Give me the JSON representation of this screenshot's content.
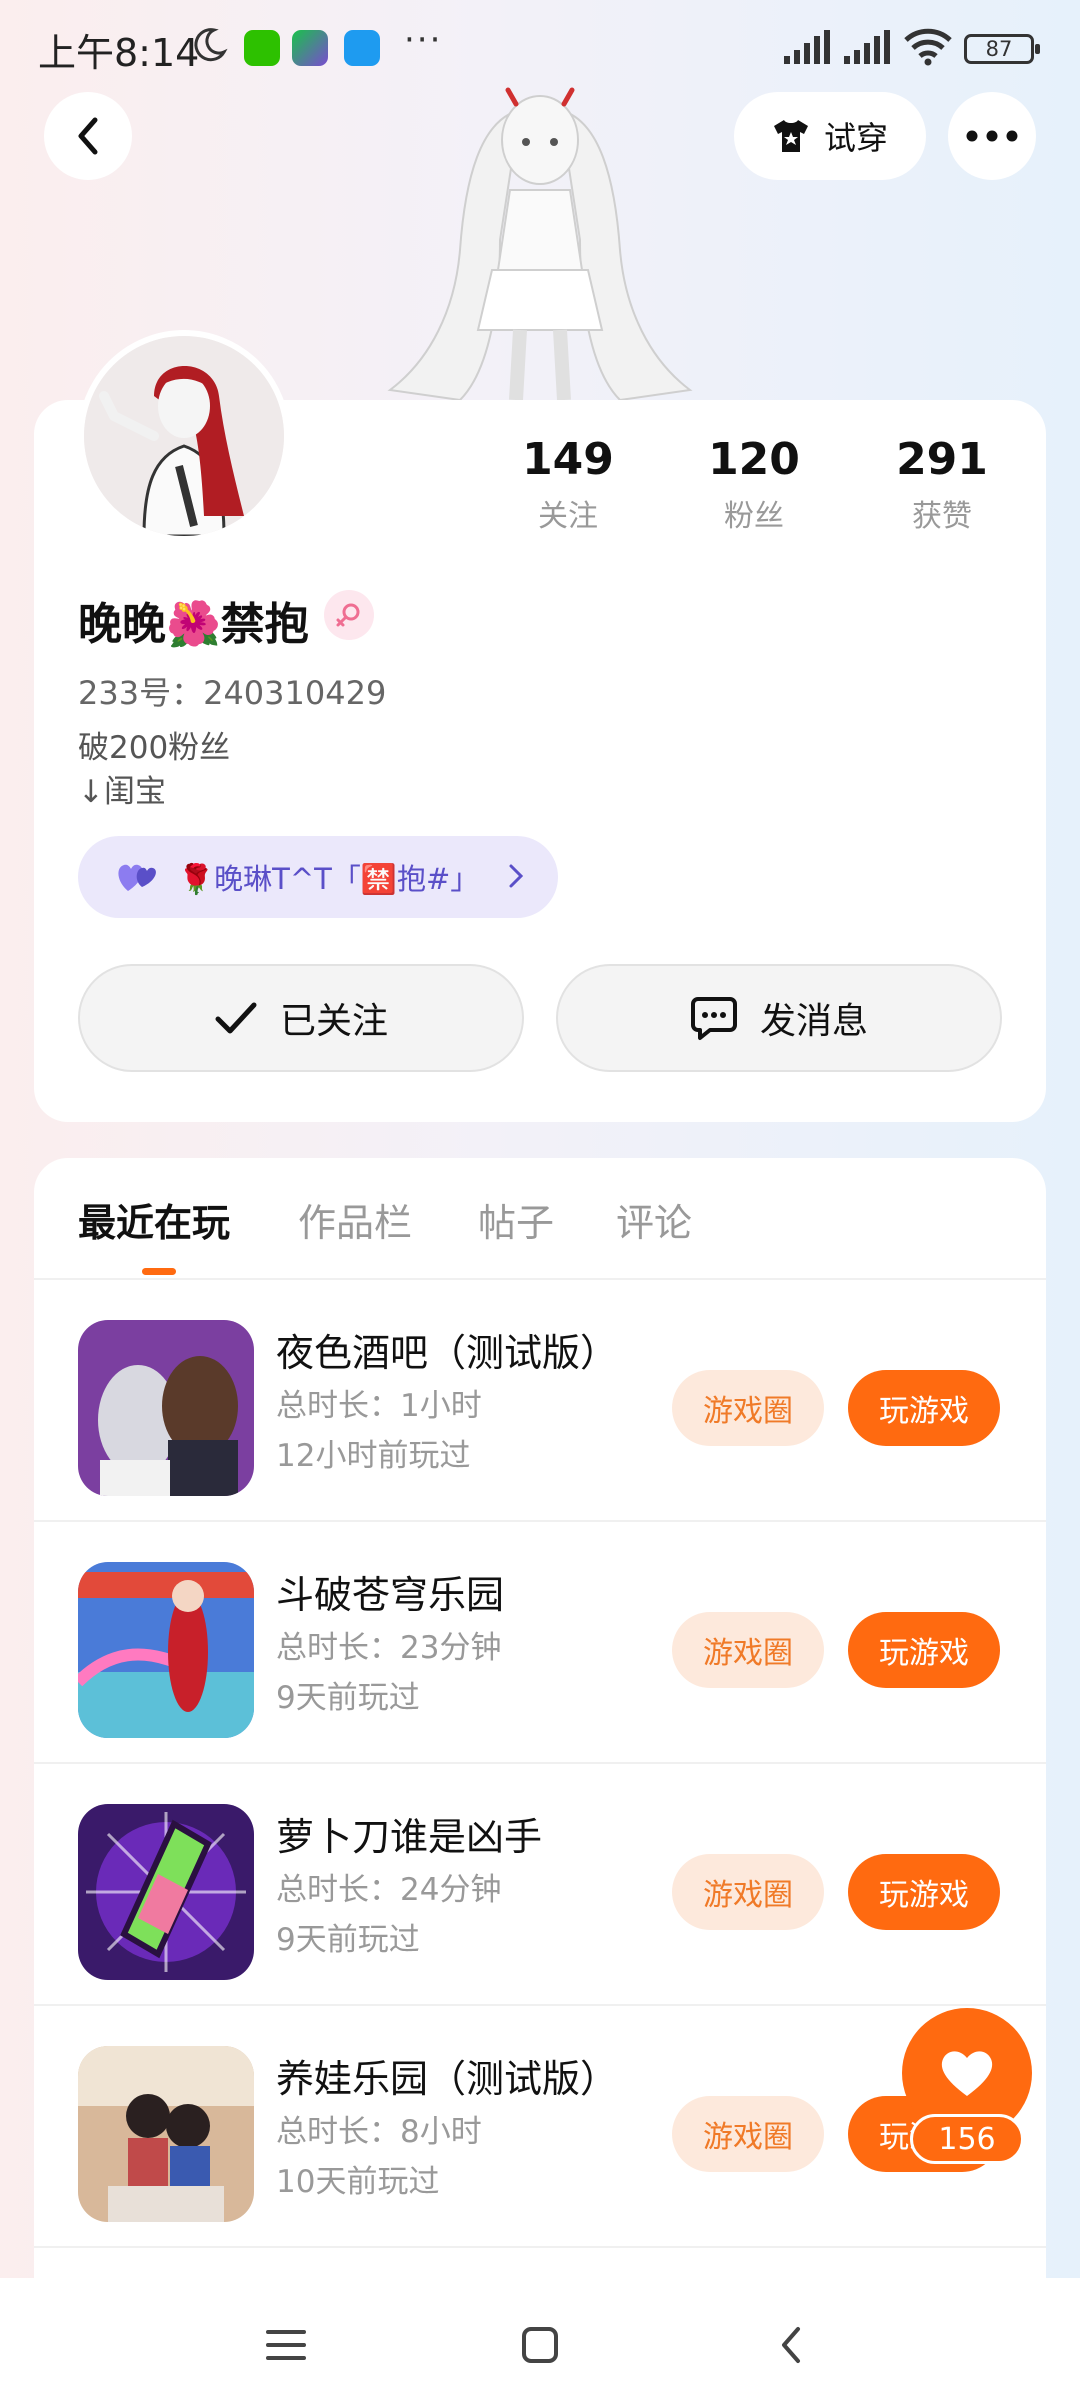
{
  "status_bar": {
    "time": "上午8:14",
    "dots": "···",
    "battery": "87"
  },
  "header": {
    "tryon_label": "试穿"
  },
  "profile": {
    "stats": [
      {
        "value": "149",
        "label": "关注"
      },
      {
        "value": "120",
        "label": "粉丝"
      },
      {
        "value": "291",
        "label": "获赞"
      }
    ],
    "nickname": "晚晚🌺禁抱",
    "user_id": "233号：240310429",
    "bio_line1": "破200粉丝",
    "bio_line2": "↓闺宝",
    "fan_badge": "🌹晚琳T^T「🈲抱#」",
    "followed_label": "已关注",
    "message_label": "发消息"
  },
  "tabs": [
    "最近在玩",
    "作品栏",
    "帖子",
    "评论"
  ],
  "games": [
    {
      "name": "夜色酒吧（测试版）",
      "duration": "总时长：1小时",
      "last_played": "12小时前玩过",
      "circle_label": "游戏圈",
      "play_label": "玩游戏"
    },
    {
      "name": "斗破苍穹乐园",
      "duration": "总时长：23分钟",
      "last_played": "9天前玩过",
      "circle_label": "游戏圈",
      "play_label": "玩游戏"
    },
    {
      "name": "萝卜刀谁是凶手",
      "duration": "总时长：24分钟",
      "last_played": "9天前玩过",
      "circle_label": "游戏圈",
      "play_label": "玩游戏"
    },
    {
      "name": "养娃乐园（测试版）",
      "duration": "总时长：8小时",
      "last_played": "10天前玩过",
      "circle_label": "游戏圈",
      "play_label": "玩游戏"
    }
  ],
  "like": {
    "count": "156"
  },
  "colors": {
    "accent": "#ff6a10",
    "accent_light": "#fde9dc",
    "badge_bg": "#ebe8fb",
    "badge_text": "#5a4fc8"
  }
}
